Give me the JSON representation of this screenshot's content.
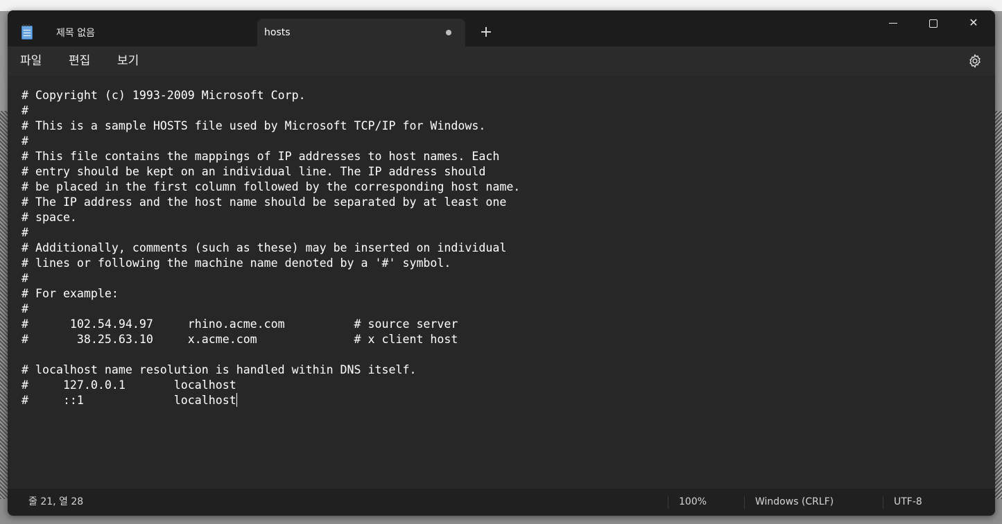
{
  "window": {
    "tabs": [
      {
        "label": "제목 없음",
        "active": false
      },
      {
        "label": "hosts",
        "active": true,
        "unsaved": true
      }
    ],
    "new_tab_symbol": "+",
    "controls": [
      "minimize-icon",
      "maximize-icon",
      "close-icon"
    ],
    "close_symbol": "✕"
  },
  "menu": {
    "file": "파일",
    "edit": "편집",
    "view": "보기",
    "settings_icon": "gear-icon"
  },
  "editor": {
    "content": "# Copyright (c) 1993-2009 Microsoft Corp.\n#\n# This is a sample HOSTS file used by Microsoft TCP/IP for Windows.\n#\n# This file contains the mappings of IP addresses to host names. Each\n# entry should be kept on an individual line. The IP address should\n# be placed in the first column followed by the corresponding host name.\n# The IP address and the host name should be separated by at least one\n# space.\n#\n# Additionally, comments (such as these) may be inserted on individual\n# lines or following the machine name denoted by a '#' symbol.\n#\n# For example:\n#\n#      102.54.94.97     rhino.acme.com          # source server\n#       38.25.63.10     x.acme.com              # x client host\n\n# localhost name resolution is handled within DNS itself.\n#     127.0.0.1       localhost\n#     ::1             localhost"
  },
  "status": {
    "position": "줄 21, 열 28",
    "zoom": "100%",
    "line_ending": "Windows (CRLF)",
    "encoding": "UTF-8"
  },
  "colors": {
    "titlebar": "#1c1c1c",
    "editor_bg": "#272727",
    "text": "#ffffff",
    "statusbar": "#202020"
  }
}
